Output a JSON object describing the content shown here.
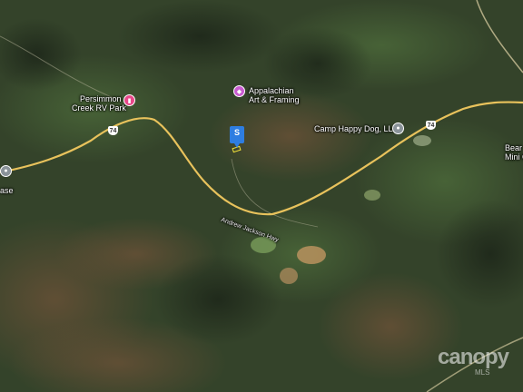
{
  "map": {
    "places": [
      {
        "name": "Persimmon Creek RV Park",
        "line1": "Persimmon",
        "line2": "Creek RV Park",
        "category": "rv-park-icon",
        "color": "#e8488a"
      },
      {
        "name": "Appalachian Art & Framing",
        "line1": "Appalachian",
        "line2": "Art & Framing",
        "category": "shopping-icon",
        "color": "#c95bd1"
      },
      {
        "name": "Camp Happy Dog, LLC",
        "line1": "Camp Happy Dog, LLC",
        "category": "place-icon",
        "color": "#8a9399"
      },
      {
        "name": "Bear Mini G",
        "line1": "Bear",
        "line2": "Mini G",
        "category": "place-icon",
        "color": "#8a9399"
      },
      {
        "name": "ase",
        "line1": "ase",
        "category": "place-icon",
        "color": "#8a9399"
      }
    ],
    "road_label": "Andrew Jackson Hwy",
    "route_shields": [
      "74",
      "74"
    ],
    "property_marker": "S",
    "watermark": "canopy",
    "watermark_sub": "MLS",
    "colors": {
      "road": "#e8c25c",
      "marker": "#2e7de1",
      "parcel": "#f6e63a"
    }
  }
}
